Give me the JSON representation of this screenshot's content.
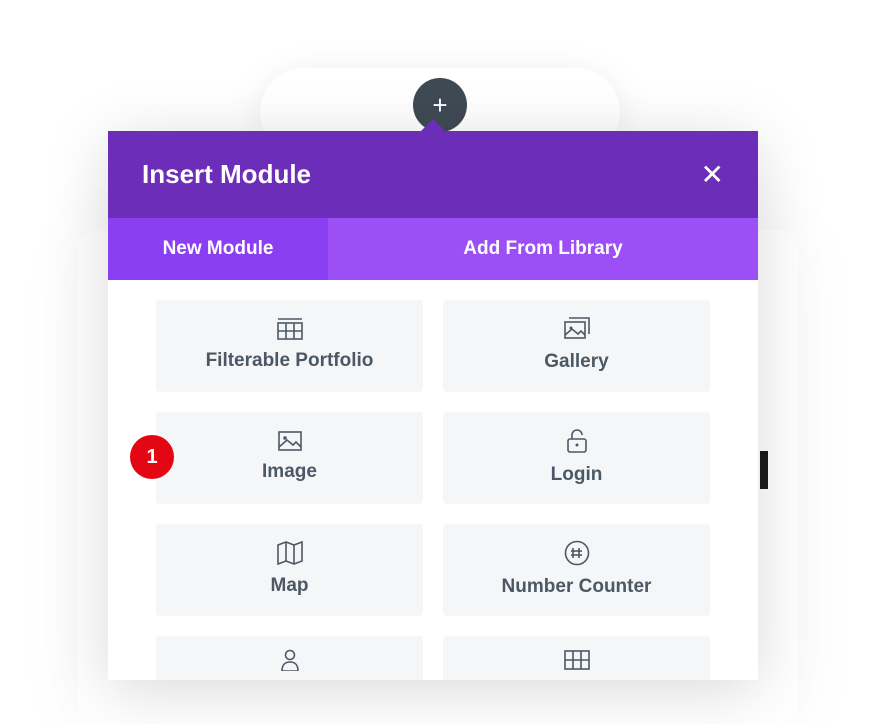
{
  "add_button": {
    "glyph": "+"
  },
  "modal": {
    "title": "Insert Module",
    "close_glyph": "✕",
    "tabs": {
      "new_module": "New Module",
      "add_from_library": "Add From Library"
    }
  },
  "modules": {
    "filterable_portfolio": "Filterable Portfolio",
    "gallery": "Gallery",
    "image": "Image",
    "login": "Login",
    "map": "Map",
    "number_counter": "Number Counter"
  },
  "annotation": {
    "badge_1": "1"
  }
}
